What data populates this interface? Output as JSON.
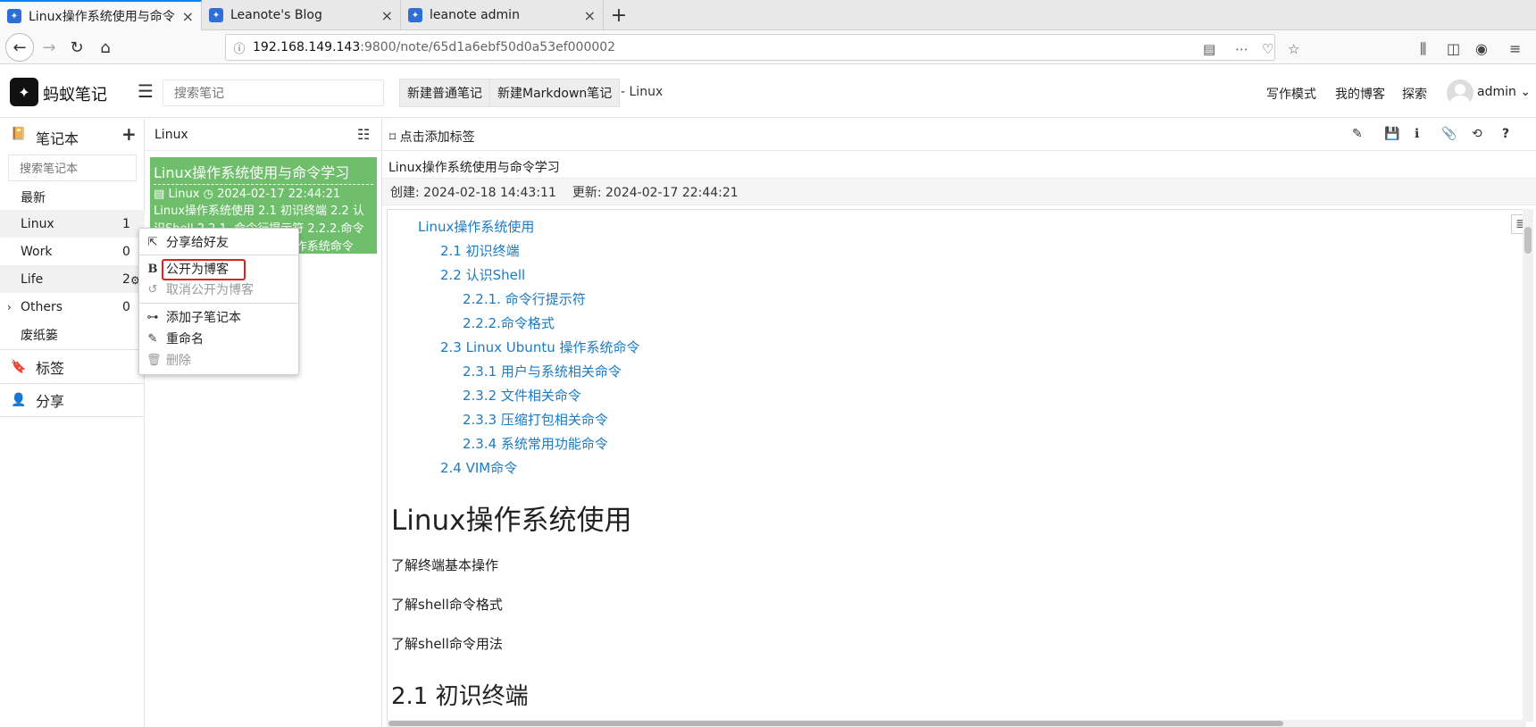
{
  "browser": {
    "tabs": [
      {
        "title": "Linux操作系统使用与命令学习",
        "close": "×"
      },
      {
        "title": "Leanote's Blog",
        "close": "×"
      },
      {
        "title": "leanote admin",
        "close": "×"
      }
    ],
    "new_tab": "+",
    "url_host": "192.168.149.143",
    "url_rest": ":9800/note/65d1a6ebf50d0a53ef000002"
  },
  "header": {
    "logo_text": "蚂蚁笔记",
    "search_placeholder": "搜索笔记",
    "new_normal_note": "新建普通笔记",
    "new_markdown_note": "新建Markdown笔记",
    "notebook_suffix": "- Linux",
    "links": {
      "writing_mode": "写作模式",
      "my_blog": "我的博客",
      "explore": "探索"
    },
    "user": "admin"
  },
  "sidebar": {
    "notebook_title": "笔记本",
    "search_placeholder": "搜索笔记本",
    "items": [
      {
        "label": "最新",
        "count": ""
      },
      {
        "label": "Linux",
        "count": "1"
      },
      {
        "label": "Work",
        "count": "0"
      },
      {
        "label": "Life",
        "count": "2"
      },
      {
        "label": "Others",
        "count": "0"
      },
      {
        "label": "废纸篓",
        "count": ""
      }
    ],
    "tags_title": "标签",
    "share_title": "分享"
  },
  "notelist": {
    "title": "Linux",
    "note": {
      "title": "Linux操作系统使用与命令学习",
      "notebook": "Linux",
      "time": "2024-02-17 22:44:21",
      "desc": "Linux操作系统使用 2.1 初识终端 2.2 认识Shell 2.2.1. 命令行提示符 2.2.2.命令格式 2.3 Linux Ubuntu 操作系统命令"
    }
  },
  "context_menu": {
    "share_friend": "分享给好友",
    "publish_blog": "公开为博客",
    "unpublish_blog": "取消公开为博客",
    "add_child": "添加子笔记本",
    "rename": "重命名",
    "delete": "删除"
  },
  "editor": {
    "add_tag": "点击添加标签",
    "title": "Linux操作系统使用与命令学习",
    "created": "创建: 2024-02-18 14:43:11",
    "updated": "更新: 2024-02-17 22:44:21",
    "toc": [
      "Linux操作系统使用",
      "2.1 初识终端",
      "2.2 认识Shell",
      "2.2.1. 命令行提示符",
      "2.2.2.命令格式",
      "2.3 Linux Ubuntu 操作系统命令",
      "2.3.1 用户与系统相关命令",
      "2.3.2 文件相关命令",
      "2.3.3 压缩打包相关命令",
      "2.3.4 系统常用功能命令",
      "2.4 VIM命令"
    ],
    "h1": "Linux操作系统使用",
    "paragraphs": [
      "了解终端基本操作",
      "了解shell命令格式",
      "了解shell命令用法"
    ],
    "h2": "2.1 初识终端"
  },
  "colors": {
    "accent": "#0a84ff",
    "note_selected": "#6ebe6c",
    "link": "#1a7bc4",
    "highlight_box": "#e02020"
  }
}
